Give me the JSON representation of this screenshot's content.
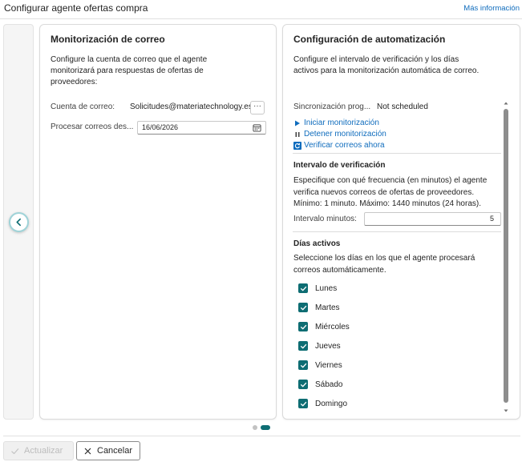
{
  "header": {
    "title": "Configurar agente ofertas compra",
    "more_info": "Más información"
  },
  "email_card": {
    "title": "Monitorización de correo",
    "description": "Configure la cuenta de correo que el agente monitorizará para respuestas de ofertas de proveedores:",
    "email_label": "Cuenta de correo:",
    "email_value": "Solicitudes@materiatechnology.es",
    "ellipsis": "···",
    "process_label": "Procesar correos des...",
    "process_date": "16/06/2026"
  },
  "automation_card": {
    "title": "Configuración de automatización",
    "description": "Configure el intervalo de verificación y los días activos para la monitorización automática de correo.",
    "sync_label": "Sincronización prog...",
    "sync_value": "Not scheduled",
    "actions": {
      "start": "Iniciar monitorización",
      "stop": "Detener monitorización",
      "verify": "Verificar correos ahora"
    },
    "interval": {
      "title": "Intervalo de verificación",
      "description": "Especifique con qué frecuencia (en minutos) el agente verifica nuevos correos de ofertas de proveedores. Mínimo: 1 minuto. Máximo: 1440 minutos (24 horas).",
      "label": "Intervalo minutos:",
      "value": "5"
    },
    "days": {
      "title": "Días activos",
      "description": "Seleccione los días en los que el agente procesará correos automáticamente.",
      "items": [
        {
          "label": "Lunes",
          "checked": true
        },
        {
          "label": "Martes",
          "checked": true
        },
        {
          "label": "Miércoles",
          "checked": true
        },
        {
          "label": "Jueves",
          "checked": true
        },
        {
          "label": "Viernes",
          "checked": true
        },
        {
          "label": "Sábado",
          "checked": true
        },
        {
          "label": "Domingo",
          "checked": true
        }
      ]
    }
  },
  "pager": {
    "total": 2,
    "active": 2
  },
  "footer": {
    "update": "Actualizar",
    "cancel": "Cancelar"
  },
  "colors": {
    "accent": "#0e6d73",
    "link": "#0f6cbd"
  },
  "icons": {
    "prev": "chevron-left-icon",
    "calendar": "calendar-icon",
    "start": "play-icon",
    "stop": "pause-icon",
    "verify": "refresh-icon",
    "update": "checkmark-icon",
    "cancel": "dismiss-icon"
  }
}
